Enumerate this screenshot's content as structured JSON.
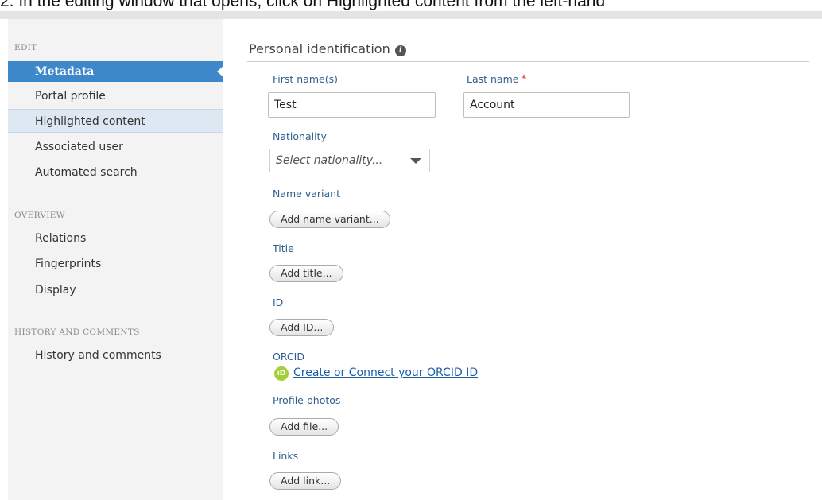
{
  "instruction": {
    "text": "2.   In the editing window that opens, click on Highlighted content from the left-hand"
  },
  "sidebar": {
    "sections": [
      {
        "title": "EDIT",
        "items": [
          "Metadata",
          "Portal profile",
          "Highlighted content",
          "Associated user",
          "Automated search"
        ]
      },
      {
        "title": "OVERVIEW",
        "items": [
          "Relations",
          "Fingerprints",
          "Display"
        ]
      },
      {
        "title": "HISTORY AND COMMENTS",
        "items": [
          "History and comments"
        ]
      }
    ],
    "active_item": "Metadata",
    "highlighted_item": "Highlighted content"
  },
  "main": {
    "section_title": "Personal identification",
    "info_icon": "i",
    "first_name": {
      "label": "First name(s)",
      "value": "Test"
    },
    "last_name": {
      "label": "Last name",
      "required_mark": "*",
      "value": "Account"
    },
    "nationality": {
      "label": "Nationality",
      "placeholder": "Select nationality..."
    },
    "name_variant": {
      "label": "Name variant",
      "button": "Add name variant..."
    },
    "title": {
      "label": "Title",
      "button": "Add title..."
    },
    "id": {
      "label": "ID",
      "button": "Add ID..."
    },
    "orcid": {
      "label": "ORCID",
      "icon": "iD",
      "link": "Create or Connect your ORCID ID"
    },
    "profile_photos": {
      "label": "Profile photos",
      "button": "Add file..."
    },
    "links": {
      "label": "Links",
      "button": "Add link..."
    }
  },
  "colors": {
    "accent": "#3d88c9",
    "highlight": "#dde8f3",
    "label": "#2f5f8f",
    "required": "#d9373a",
    "link": "#1a5fa8",
    "orcid": "#a6ce39"
  }
}
